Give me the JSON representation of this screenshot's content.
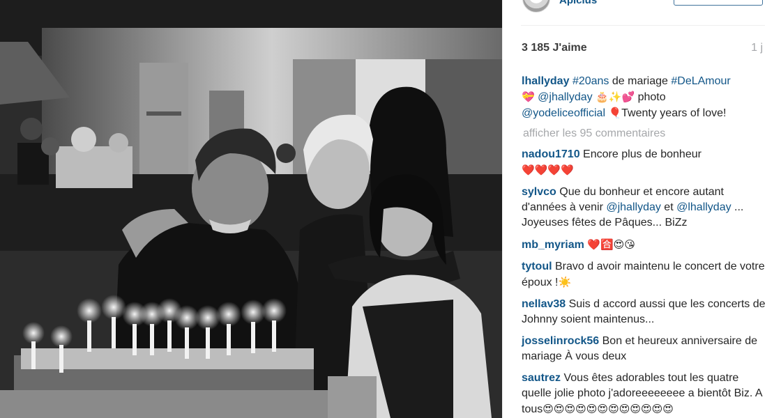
{
  "post": {
    "author": "Apicius",
    "likes": "3 185 J'aime",
    "time": "1 j",
    "caption": {
      "user": "lhallyday",
      "tag1": "#20ans",
      "text1": " de mariage ",
      "tag2": "#DeLAmour",
      "emoji1": "💝",
      "mention1": "@jhallyday",
      "emoji2": "🎂✨💕",
      "text2": " photo",
      "mention2": "@yodeliceofficial",
      "emoji3": "🎈",
      "text3": "Twenty years of love!"
    },
    "more_comments": "afficher les 95 commentaires"
  },
  "comments": [
    {
      "user": "nadou1710",
      "text": "Encore plus de bonheur",
      "emoji": "❤️❤️❤️❤️"
    },
    {
      "user": "sylvco",
      "text": "Que du bonheur et encore autant d'années à venir ",
      "mention1": "@jhallyday",
      "mid": " et ",
      "mention2": "@lhallyday",
      "text2": " ... Joyeuses fêtes de Pâques... BiZz"
    },
    {
      "user": "mb_myriam",
      "text": "",
      "emoji": "❤️🈴😍😘"
    },
    {
      "user": "tytoul",
      "text": "Bravo d avoir maintenu le concert de votre époux !",
      "emoji": "☀️"
    },
    {
      "user": "nellav38",
      "text": "Suis d accord aussi que les concerts de Johnny soient maintenus..."
    },
    {
      "user": "josselinrock56",
      "text": "Bon et heureux anniversaire de mariage À vous deux"
    },
    {
      "user": "sautrez",
      "text": "Vous êtes adorables tout les quatre quelle jolie photo j'adoreeeeeeee a bientôt Biz. A tous",
      "emoji": "😍😍😍😍😍😍😍😍😍😍😍😍"
    }
  ],
  "colors": {
    "link": "#125688",
    "muted": "#a5a7aa",
    "text": "#262626",
    "photo_bg": "#3a3a3a"
  }
}
